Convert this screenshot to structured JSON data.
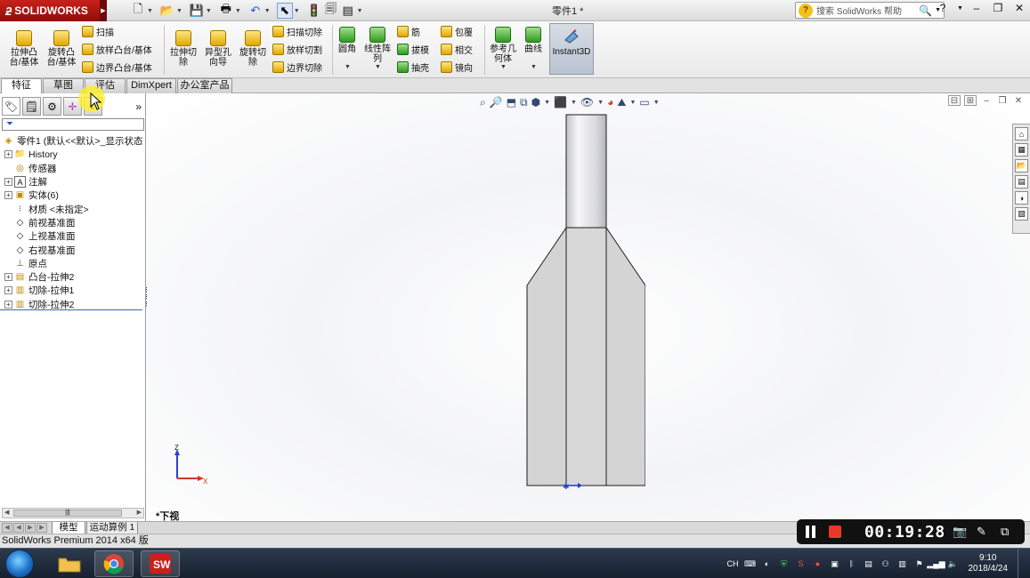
{
  "app": {
    "logo_text": "SOLIDWORKS",
    "doc_title": "零件1 *",
    "help_search_placeholder": "搜索 SolidWorks 帮助"
  },
  "ribbon": {
    "extrude_boss": "拉伸凸台/基体",
    "revolve_boss": "旋转凸台/基体",
    "sweep": "扫描",
    "loft_boss": "放样凸台/基体",
    "boundary_boss": "边界凸台/基体",
    "extrude_cut": "拉伸切除",
    "hole_wizard": "异型孔向导",
    "revolve_cut": "旋转切除",
    "sweep_cut": "扫描切除",
    "loft_cut": "放样切割",
    "boundary_cut": "边界切除",
    "fillet": "圆角",
    "linear_pattern": "线性阵列",
    "rib": "筋",
    "draft": "拔模",
    "shell": "抽壳",
    "wrap": "包覆",
    "intersect": "相交",
    "mirror": "镜向",
    "ref_geometry": "参考几何体",
    "curves": "曲线",
    "instant3d": "Instant3D"
  },
  "tabs": [
    "特征",
    "草图",
    "评估",
    "DimXpert",
    "办公室产品"
  ],
  "tree": {
    "root": "零件1 (默认<<默认>_显示状态",
    "items": [
      {
        "label": "History",
        "expand": true
      },
      {
        "label": "传感器",
        "expand": false
      },
      {
        "label": "注解",
        "expand": true
      },
      {
        "label": "实体(6)",
        "expand": true
      },
      {
        "label": "材质 <未指定>",
        "expand": false
      },
      {
        "label": "前视基准面",
        "expand": false
      },
      {
        "label": "上视基准面",
        "expand": false
      },
      {
        "label": "右视基准面",
        "expand": false
      },
      {
        "label": "原点",
        "expand": false
      },
      {
        "label": "凸台-拉伸2",
        "expand": true
      },
      {
        "label": "切除-拉伸1",
        "expand": true
      },
      {
        "label": "切除-拉伸2",
        "expand": true
      }
    ]
  },
  "viewport": {
    "view_name": "*下视",
    "triad_z": "Z",
    "triad_x": "X"
  },
  "model_tabs": [
    "模型",
    "运动算例 1"
  ],
  "status_text": "SolidWorks Premium 2014 x64 版",
  "recorder": {
    "time": "00:19:28"
  },
  "taskbar": {
    "lang": "CH",
    "time": "9:10",
    "date": "2018/4/24"
  },
  "colors": {
    "brand_red": "#c8211b",
    "record_red": "#e8392b",
    "highlight_yellow": "#ffee28"
  }
}
